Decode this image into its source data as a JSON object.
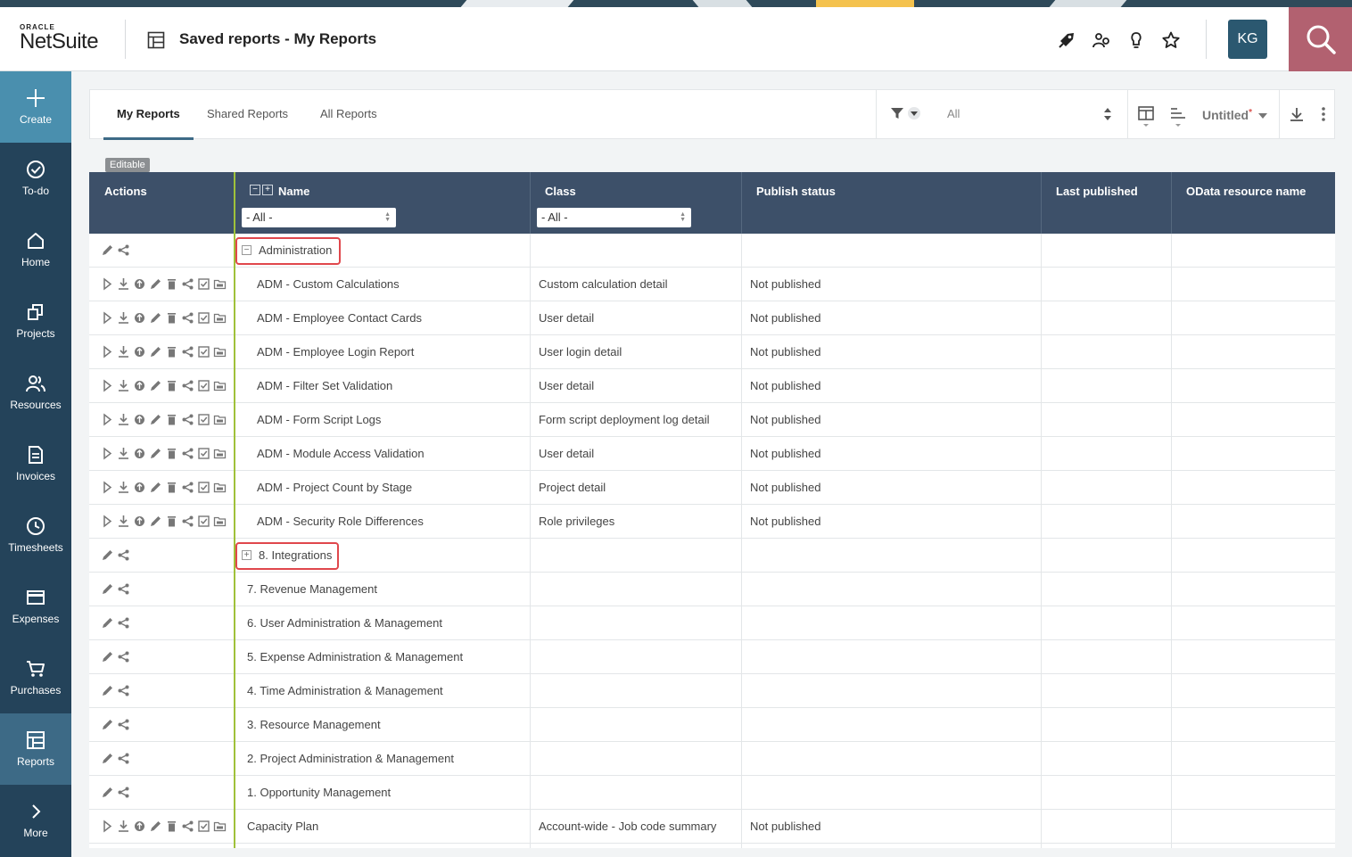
{
  "brand": {
    "oracle": "ORACLE",
    "netsuite": "NetSuite"
  },
  "header": {
    "title": "Saved reports - My Reports",
    "avatar": "KG"
  },
  "sidebar": [
    {
      "label": "Create",
      "icon": "plus-icon"
    },
    {
      "label": "To-do",
      "icon": "check-circle-icon"
    },
    {
      "label": "Home",
      "icon": "home-icon"
    },
    {
      "label": "Projects",
      "icon": "projects-icon"
    },
    {
      "label": "Resources",
      "icon": "people-icon"
    },
    {
      "label": "Invoices",
      "icon": "invoice-icon"
    },
    {
      "label": "Timesheets",
      "icon": "clock-icon"
    },
    {
      "label": "Expenses",
      "icon": "card-icon"
    },
    {
      "label": "Purchases",
      "icon": "cart-icon"
    },
    {
      "label": "Reports",
      "icon": "reports-icon"
    },
    {
      "label": "More",
      "icon": "chevron-right-icon"
    }
  ],
  "tabs": [
    "My Reports",
    "Shared Reports",
    "All Reports"
  ],
  "toolbar": {
    "filter_value": "All",
    "view_name": "Untitled",
    "unsaved_mark": "*"
  },
  "badge": "Editable",
  "columns": {
    "actions": "Actions",
    "name": "Name",
    "class": "Class",
    "publish_status": "Publish status",
    "last_published": "Last published",
    "odata": "OData resource name"
  },
  "filters": {
    "name": "- All -",
    "class": "- All -"
  },
  "rows": [
    {
      "type": "group",
      "toggle": "−",
      "name": "Administration",
      "class": "",
      "status": ""
    },
    {
      "type": "report",
      "name": "ADM - Custom Calculations",
      "class": "Custom calculation detail",
      "status": "Not published"
    },
    {
      "type": "report",
      "name": "ADM - Employee Contact Cards",
      "class": "User detail",
      "status": "Not published"
    },
    {
      "type": "report",
      "name": "ADM - Employee Login Report",
      "class": "User login detail",
      "status": "Not published"
    },
    {
      "type": "report",
      "name": "ADM - Filter Set Validation",
      "class": "User detail",
      "status": "Not published"
    },
    {
      "type": "report",
      "name": "ADM - Form Script Logs",
      "class": "Form script deployment log detail",
      "status": "Not published"
    },
    {
      "type": "report",
      "name": "ADM - Module Access Validation",
      "class": "User detail",
      "status": "Not published"
    },
    {
      "type": "report",
      "name": "ADM - Project Count by Stage",
      "class": "Project detail",
      "status": "Not published"
    },
    {
      "type": "report",
      "name": "ADM - Security Role Differences",
      "class": "Role privileges",
      "status": "Not published"
    },
    {
      "type": "group",
      "toggle": "+",
      "name": "8. Integrations",
      "class": "",
      "status": ""
    },
    {
      "type": "folder",
      "name": "7. Revenue Management",
      "class": "",
      "status": ""
    },
    {
      "type": "folder",
      "name": "6. User Administration & Management",
      "class": "",
      "status": ""
    },
    {
      "type": "folder",
      "name": "5. Expense Administration & Management",
      "class": "",
      "status": ""
    },
    {
      "type": "folder",
      "name": "4. Time Administration & Management",
      "class": "",
      "status": ""
    },
    {
      "type": "folder",
      "name": "3. Resource Management",
      "class": "",
      "status": ""
    },
    {
      "type": "folder",
      "name": "2. Project Administration & Management",
      "class": "",
      "status": ""
    },
    {
      "type": "folder",
      "name": "1. Opportunity Management",
      "class": "",
      "status": ""
    },
    {
      "type": "top-report",
      "name": "Capacity Plan",
      "class": "Account-wide - Job code summary",
      "status": "Not published"
    }
  ],
  "colors": {
    "sidebar": "#24435a",
    "header_row": "#3d5069",
    "accent": "#3d6a86",
    "search": "#b26170",
    "highlight": "#e0474c"
  }
}
